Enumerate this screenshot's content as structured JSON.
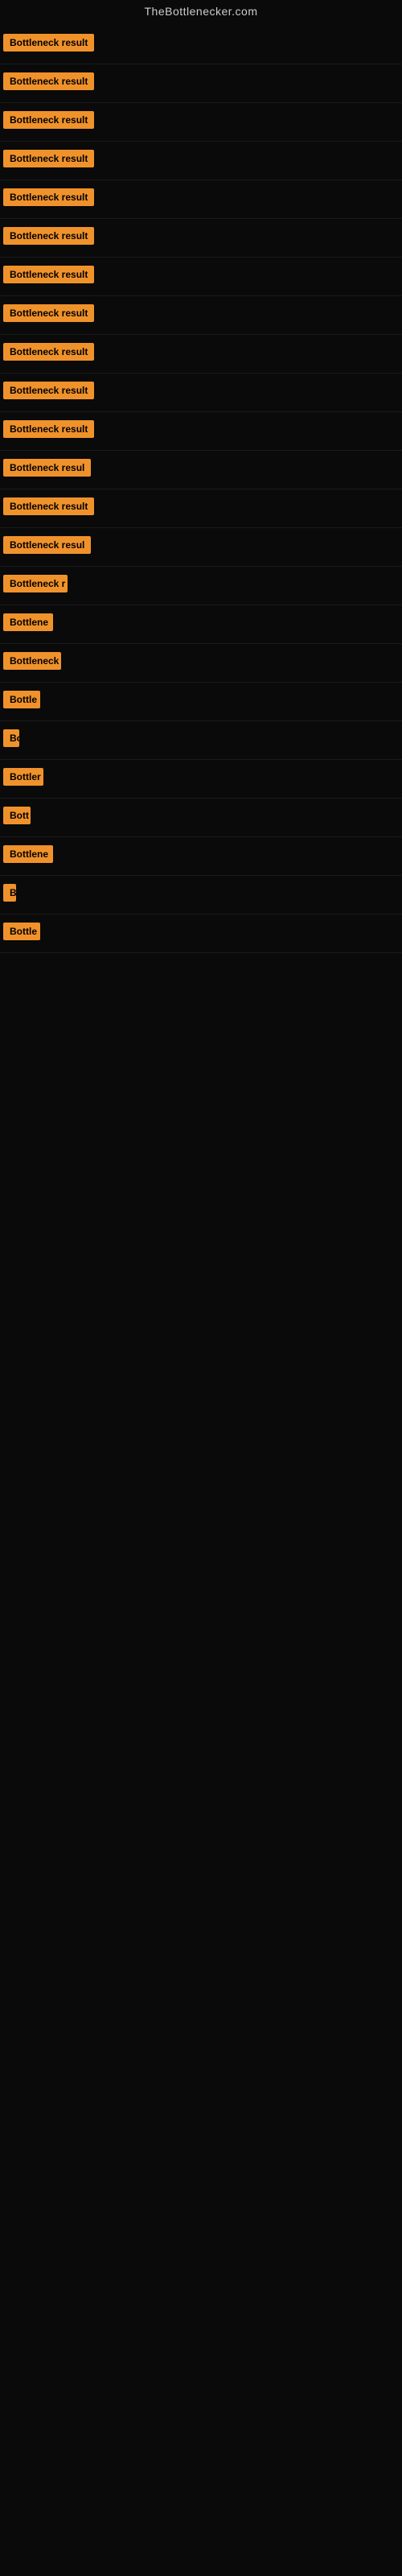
{
  "site": {
    "title": "TheBottlenecker.com"
  },
  "results": [
    {
      "id": 1,
      "label": "Bottleneck result",
      "width": 130
    },
    {
      "id": 2,
      "label": "Bottleneck result",
      "width": 130
    },
    {
      "id": 3,
      "label": "Bottleneck result",
      "width": 130
    },
    {
      "id": 4,
      "label": "Bottleneck result",
      "width": 130
    },
    {
      "id": 5,
      "label": "Bottleneck result",
      "width": 130
    },
    {
      "id": 6,
      "label": "Bottleneck result",
      "width": 130
    },
    {
      "id": 7,
      "label": "Bottleneck result",
      "width": 130
    },
    {
      "id": 8,
      "label": "Bottleneck result",
      "width": 130
    },
    {
      "id": 9,
      "label": "Bottleneck result",
      "width": 130
    },
    {
      "id": 10,
      "label": "Bottleneck result",
      "width": 130
    },
    {
      "id": 11,
      "label": "Bottleneck result",
      "width": 130
    },
    {
      "id": 12,
      "label": "Bottleneck resul",
      "width": 115
    },
    {
      "id": 13,
      "label": "Bottleneck result",
      "width": 130
    },
    {
      "id": 14,
      "label": "Bottleneck resul",
      "width": 115
    },
    {
      "id": 15,
      "label": "Bottleneck r",
      "width": 80
    },
    {
      "id": 16,
      "label": "Bottlene",
      "width": 62
    },
    {
      "id": 17,
      "label": "Bottleneck",
      "width": 72
    },
    {
      "id": 18,
      "label": "Bottle",
      "width": 46
    },
    {
      "id": 19,
      "label": "Bo",
      "width": 20
    },
    {
      "id": 20,
      "label": "Bottler",
      "width": 50
    },
    {
      "id": 21,
      "label": "Bott",
      "width": 34
    },
    {
      "id": 22,
      "label": "Bottlene",
      "width": 62
    },
    {
      "id": 23,
      "label": "B",
      "width": 14
    },
    {
      "id": 24,
      "label": "Bottle",
      "width": 46
    }
  ]
}
